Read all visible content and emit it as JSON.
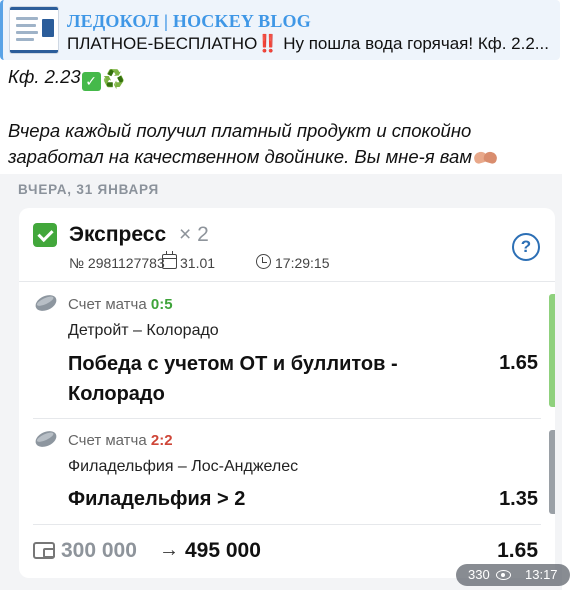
{
  "reply": {
    "channel_title": "ЛЕДОКОЛ | HOCKEY BLOG",
    "text_before": "ПЛАТНОЕ-БЕСПЛАТНО",
    "emoji_bangbang": "‼️",
    "text_after": " Ну пошла вода горячая! Кф. 2.2..."
  },
  "message": {
    "line1": "Кф. 2.23",
    "line1_emoji_check": "✅",
    "line1_emoji_recycle": "♻️",
    "line2": "Вчера каждый получил платный продукт и спокойно",
    "line3": "заработал на качественном двойнике. Вы мне-я вам",
    "line3_emoji": "handshake"
  },
  "bet_slip": {
    "date_label": "ВЧЕРА, 31 ЯНВАРЯ",
    "title": "Экспресс",
    "count": "× 2",
    "bet_number": "№ 2981127783",
    "date": "31.01",
    "time": "17:29:15",
    "help_label": "?",
    "events": [
      {
        "score_label": "Счет матча ",
        "score": "0:5",
        "status_color": "#3ea33a",
        "teams": "Детройт – Колорадо",
        "pick_line1": "Победа с учетом ОТ и буллитов -",
        "pick_line2": "Колорадо",
        "odd": "1.65"
      },
      {
        "score_label": "Счет матча ",
        "score": "2:2",
        "status_color": "#cf4638",
        "teams": "Филадельфия – Лос-Анджелес",
        "pick_line1": "Филадельфия > 2",
        "pick_line2": "",
        "odd": "1.35"
      }
    ],
    "stake": "300 000",
    "arrow": "→",
    "payout": "495 000",
    "total_odd": "1.65"
  },
  "footer": {
    "views": "330",
    "time": "13:17"
  },
  "icons": [
    "reply-thumbnail",
    "check-icon",
    "help-icon",
    "calendar-icon",
    "clock-icon",
    "puck-icon",
    "wallet-icon",
    "eye-icon"
  ]
}
